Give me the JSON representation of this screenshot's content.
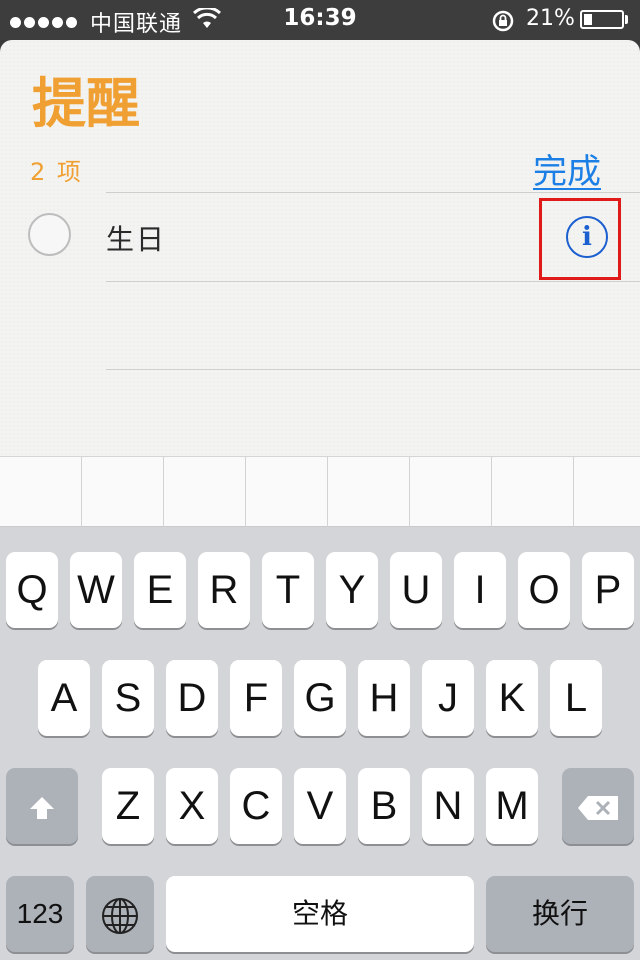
{
  "status_bar": {
    "carrier": "中国联通",
    "time": "16:39",
    "battery_percent": "21%",
    "battery_level": 0.21,
    "signal_dots": 5,
    "icons": [
      "signal-dots-icon",
      "wifi-icon",
      "orientation-lock-icon",
      "battery-icon"
    ]
  },
  "reminders": {
    "title": "提醒",
    "count": "2 项",
    "done_label": "完成",
    "items": [
      {
        "text": "生日",
        "checked": false
      }
    ],
    "info_icon": "i",
    "colors": {
      "title": "#f0a033",
      "accent": "#1b7fe6",
      "highlight": "#e01919"
    }
  },
  "keyboard": {
    "row1": [
      "Q",
      "W",
      "E",
      "R",
      "T",
      "Y",
      "U",
      "I",
      "O",
      "P"
    ],
    "row2": [
      "A",
      "S",
      "D",
      "F",
      "G",
      "H",
      "J",
      "K",
      "L"
    ],
    "row3": [
      "Z",
      "X",
      "C",
      "V",
      "B",
      "N",
      "M"
    ],
    "shift_icon": "shift-arrow-icon",
    "delete_icon": "backspace-icon",
    "numbers_label": "123",
    "globe_icon": "globe-icon",
    "space_label": "空格",
    "return_label": "换行"
  }
}
